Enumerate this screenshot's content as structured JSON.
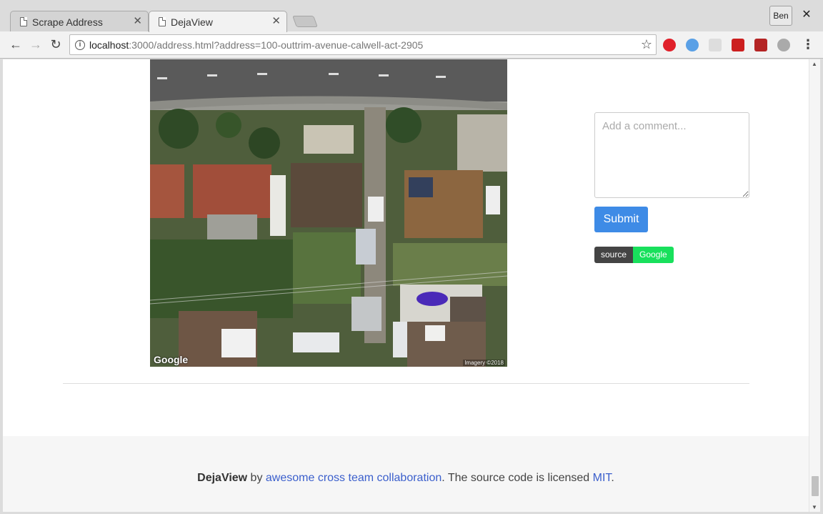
{
  "browser": {
    "tabs": [
      {
        "title": "Scrape Address",
        "active": false
      },
      {
        "title": "DejaView",
        "active": true
      }
    ],
    "profile_name": "Ben",
    "close_glyph": "✕",
    "url_host": "localhost",
    "url_rest": ":3000/address.html?address=100-outtrim-avenue-calwell-act-2905",
    "extensions": [
      {
        "name": "opera-icon",
        "color": "#e0202a"
      },
      {
        "name": "feedly-icon",
        "color": "#5aa0e6"
      },
      {
        "name": "handshake-icon",
        "color": "#bbbbbb"
      },
      {
        "name": "lastpass-icon",
        "color": "#cc1f1f"
      },
      {
        "name": "puzzle-icon",
        "color": "#b42424"
      },
      {
        "name": "sync-icon",
        "color": "#aaaaaa"
      }
    ]
  },
  "page": {
    "satellite": {
      "watermark": "Google",
      "imagery": "Imagery ©2018"
    },
    "comment_placeholder": "Add a comment...",
    "submit_label": "Submit",
    "badge": {
      "left": "source",
      "right": "Google"
    },
    "footer": {
      "brand": "DejaView",
      "by": " by ",
      "link": "awesome cross team collaboration",
      "middle": ". The source code is licensed ",
      "license": "MIT",
      "end": "."
    }
  }
}
